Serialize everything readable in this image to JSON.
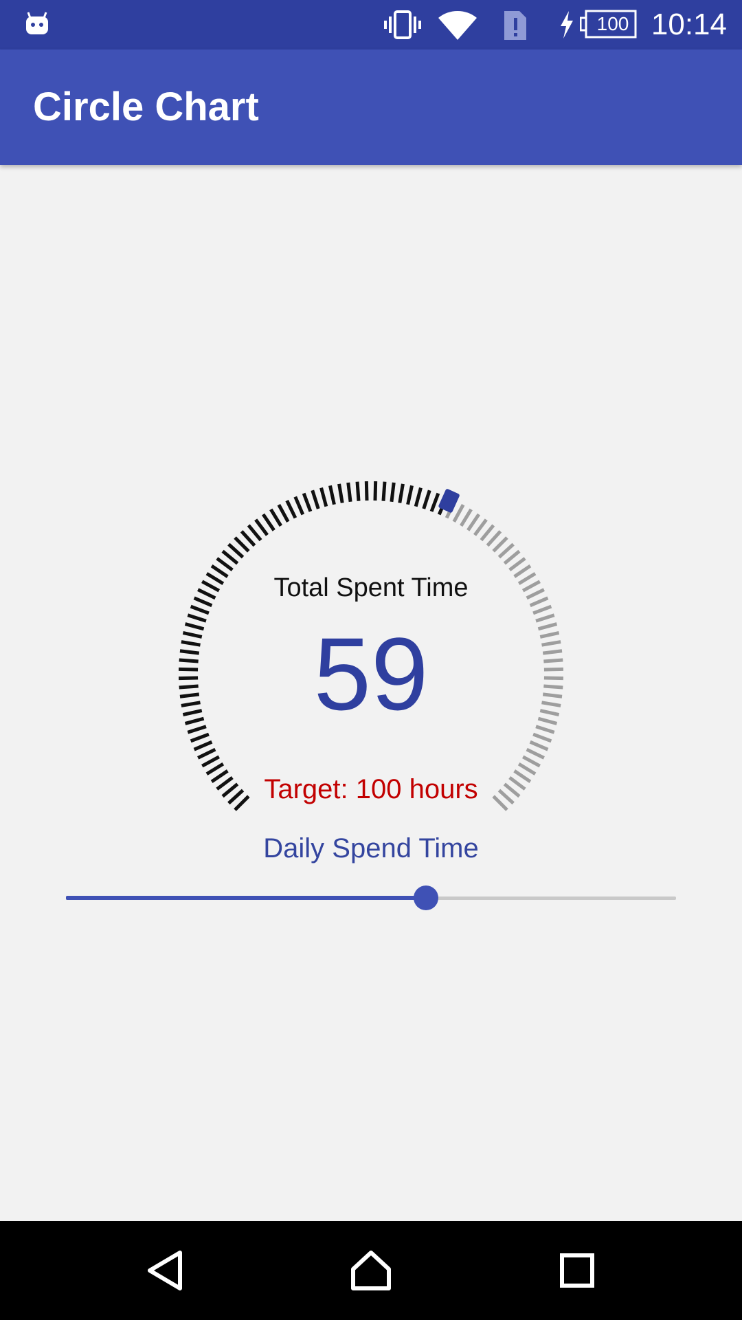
{
  "status_bar": {
    "time": "10:14",
    "battery_level": "100",
    "icons": [
      "android-debug-icon",
      "vibrate-icon",
      "wifi-icon",
      "sim-alert-icon",
      "charging-icon",
      "battery-icon"
    ],
    "background": "#2f3f9f"
  },
  "app_bar": {
    "title": "Circle Chart",
    "background": "#3f51b5"
  },
  "gauge": {
    "title": "Total Spent Time",
    "value": "59",
    "target_label": "Target: 100 hours",
    "progress_fraction": 0.59,
    "tick_count": 100,
    "colors": {
      "filled": "#111111",
      "empty": "#9e9e9e",
      "marker": "#2f3f9f",
      "value": "#2f3f9f",
      "target": "#c20000"
    }
  },
  "slider": {
    "label": "Daily Spend Time",
    "value_fraction": 0.59,
    "colors": {
      "active": "#3f51b5",
      "inactive": "#c9c9c9"
    }
  },
  "nav_bar": {
    "buttons": [
      "back-icon",
      "home-icon",
      "recents-icon"
    ]
  }
}
